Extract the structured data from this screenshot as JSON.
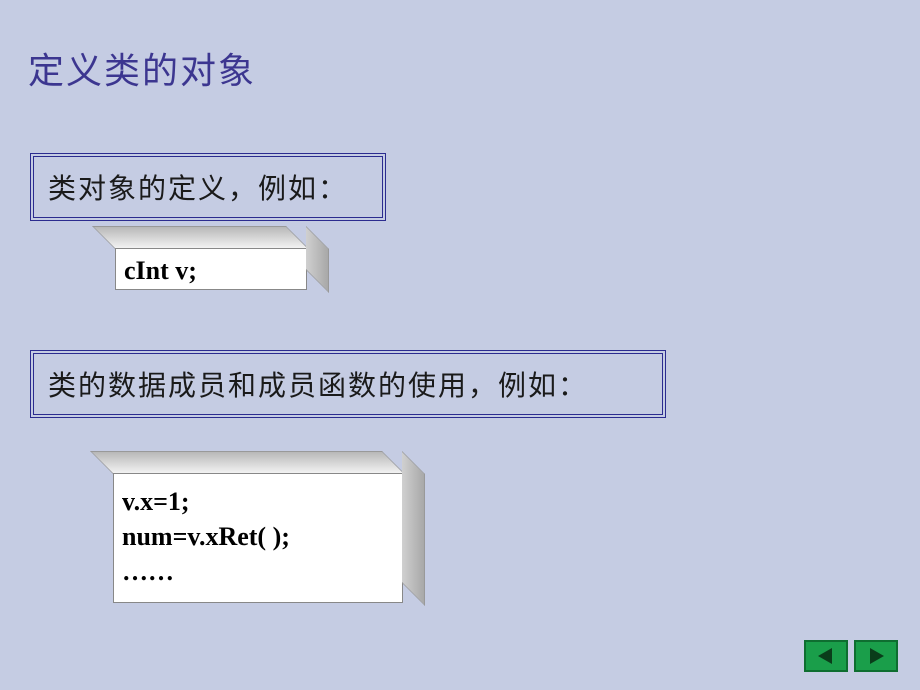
{
  "title": "定义类的对象",
  "caption1": "类对象的定义，例如：",
  "caption2": "类的数据成员和成员函数的使用，例如：",
  "code1": "cInt v;",
  "code2": "v.x=1;\nnum=v.xRet( );\n……"
}
